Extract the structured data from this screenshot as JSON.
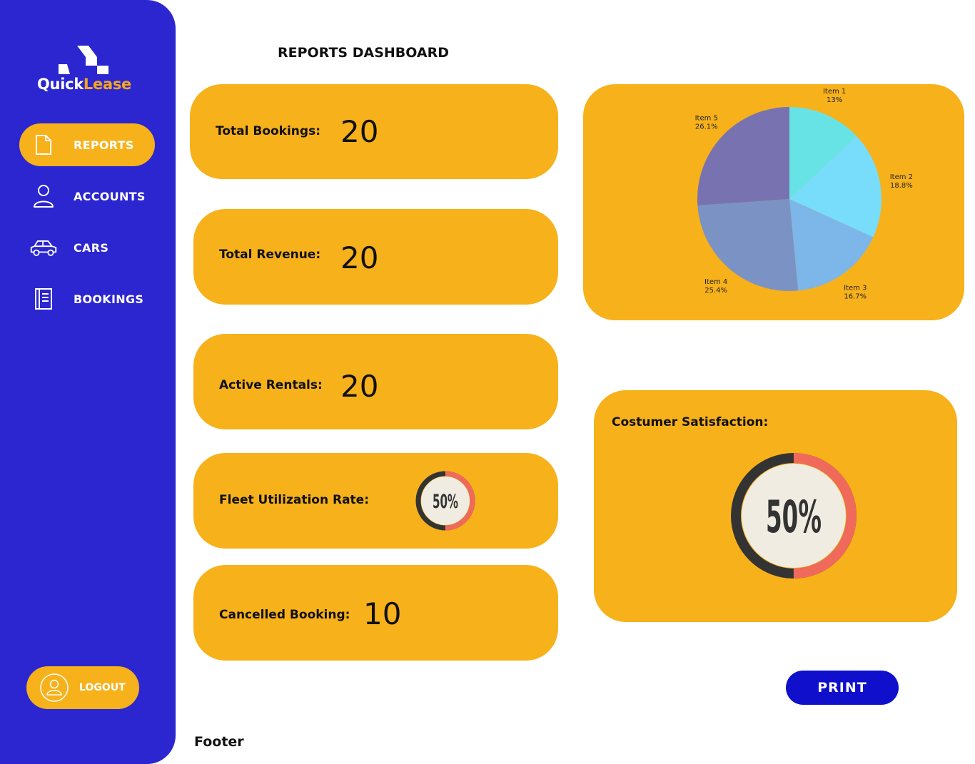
{
  "app": {
    "brand_part1": "Quick",
    "brand_part2": "Lease"
  },
  "sidebar": {
    "items": [
      {
        "label": "REPORTS",
        "icon": "document-icon",
        "active": true
      },
      {
        "label": "ACCOUNTS",
        "icon": "user-icon",
        "active": false
      },
      {
        "label": "CARS",
        "icon": "car-icon",
        "active": false
      },
      {
        "label": "BOOKINGS",
        "icon": "book-icon",
        "active": false
      }
    ],
    "logout_label": "LOGOUT"
  },
  "header": {
    "title": "REPORTS DASHBOARD"
  },
  "stats": {
    "total_bookings": {
      "label": "Total Bookings:",
      "value": "20"
    },
    "total_revenue": {
      "label": "Total Revenue:",
      "value": "20"
    },
    "active_rentals": {
      "label": "Active Rentals:",
      "value": "20"
    },
    "fleet_utilization": {
      "label": "Fleet Utilization Rate:",
      "value": "50%",
      "fraction": 0.5
    },
    "cancelled_booking": {
      "label": "Cancelled Booking:",
      "value": "10"
    }
  },
  "satisfaction": {
    "label": "Costumer Satisfaction:",
    "value": "50%",
    "fraction": 0.5
  },
  "chart_data": {
    "type": "pie",
    "slices": [
      {
        "name": "Item 1",
        "value": 13.0,
        "label": "13%",
        "color": "#67E3E6"
      },
      {
        "name": "Item 2",
        "value": 18.8,
        "label": "18.8%",
        "color": "#77DDFA"
      },
      {
        "name": "Item 3",
        "value": 16.7,
        "label": "16.7%",
        "color": "#7DB6E8"
      },
      {
        "name": "Item 4",
        "value": 25.4,
        "label": "25.4%",
        "color": "#7A92C4"
      },
      {
        "name": "Item 5",
        "value": 26.1,
        "label": "26.1%",
        "color": "#7873B0"
      }
    ]
  },
  "actions": {
    "print_label": "PRINT"
  },
  "footer": {
    "text": "Footer"
  },
  "colors": {
    "sidebar": "#2B26CF",
    "card": "#F7B11A",
    "print_button": "#0F0FCC",
    "gauge_filled": "#F06A5C",
    "gauge_track": "#333333",
    "gauge_center": "#F0ECE2"
  }
}
